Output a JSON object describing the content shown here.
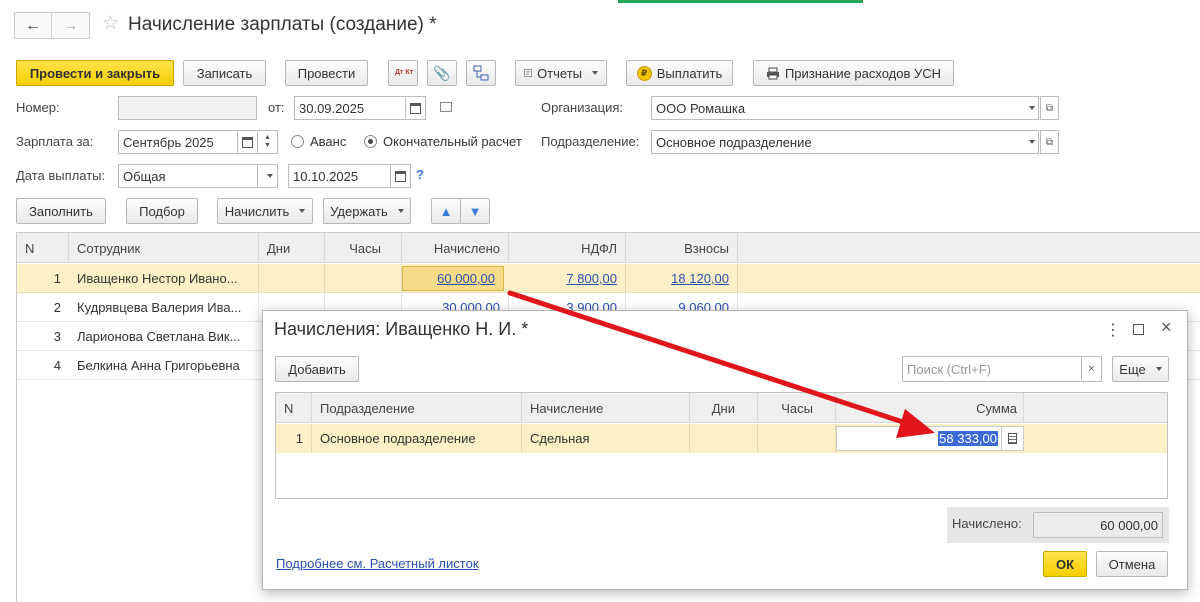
{
  "window": {
    "title": "Начисление зарплаты (создание) *"
  },
  "toolbar": {
    "post_close": "Провести и закрыть",
    "write": "Записать",
    "post": "Провести",
    "dtkt": "Дт Кт",
    "reports": "Отчеты",
    "pay": "Выплатить",
    "usn": "Признание расходов УСН"
  },
  "form": {
    "number_label": "Номер:",
    "number_value": "",
    "from_label": "от:",
    "date_value": "30.09.2025",
    "org_label": "Организация:",
    "org_value": "ООО Ромашка",
    "salary_for_label": "Зарплата за:",
    "salary_for_value": "Сентябрь 2025",
    "advance_label": "Аванс",
    "final_label": "Окончательный расчет",
    "dept_label": "Подразделение:",
    "dept_value": "Основное подразделение",
    "pay_date_label": "Дата выплаты:",
    "pay_type_value": "Общая",
    "pay_date_value": "10.10.2025",
    "help": "?"
  },
  "actions": {
    "fill": "Заполнить",
    "select": "Подбор",
    "accrue": "Начислить",
    "deduct": "Удержать"
  },
  "main_table": {
    "headers": {
      "n": "N",
      "employee": "Сотрудник",
      "days": "Дни",
      "hours": "Часы",
      "accrued": "Начислено",
      "ndfl": "НДФЛ",
      "contrib": "Взносы"
    },
    "rows": [
      {
        "n": "1",
        "employee": "Иващенко Нестор Ивано...",
        "accrued": "60 000,00",
        "ndfl": "7 800,00",
        "contrib": "18 120,00"
      },
      {
        "n": "2",
        "employee": "Кудрявцева Валерия Ива...",
        "accrued": "30 000,00",
        "ndfl": "3 900,00",
        "contrib": "9 060,00"
      },
      {
        "n": "3",
        "employee": "Ларионова Светлана Вик...",
        "accrued": "",
        "ndfl": "",
        "contrib": ""
      },
      {
        "n": "4",
        "employee": "Белкина Анна Григорьевна",
        "accrued": "",
        "ndfl": "",
        "contrib": ""
      }
    ]
  },
  "dialog": {
    "title": "Начисления: Иващенко Н. И. *",
    "add": "Добавить",
    "search_placeholder": "Поиск (Ctrl+F)",
    "clear": "×",
    "more": "Еще",
    "headers": {
      "n": "N",
      "dept": "Подразделение",
      "accrual": "Начисление",
      "days": "Дни",
      "hours": "Часы",
      "sum": "Сумма"
    },
    "rows": [
      {
        "n": "1",
        "dept": "Основное подразделение",
        "accrual": "Сдельная",
        "sum": "58 333,00"
      }
    ],
    "total_label": "Начислено:",
    "total_value": "60 000,00",
    "payslip_link": "Подробнее см. Расчетный листок",
    "ok": "ОК",
    "cancel": "Отмена"
  },
  "colors": {
    "accent_yellow": "#f5cf00",
    "selection_row": "#fbf0c6",
    "arrow_red": "#e0161b",
    "link": "#2b4fb0"
  }
}
